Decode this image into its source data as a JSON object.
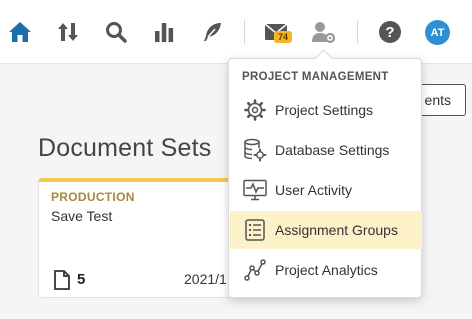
{
  "topbar": {
    "nav": [
      {
        "name": "home-icon",
        "active": true
      },
      {
        "name": "sort-arrows-icon"
      },
      {
        "name": "search-icon"
      },
      {
        "name": "bar-chart-icon"
      },
      {
        "name": "feather-icon"
      },
      {
        "name": "mail-icon"
      },
      {
        "name": "user-settings-icon"
      },
      {
        "name": "help-icon"
      }
    ],
    "mail_badge": "74",
    "avatar_initials": "AT",
    "accent_color": "#1b6fa6"
  },
  "background": {
    "button_label": "ents",
    "section_title": "Document Sets",
    "card": {
      "tag": "PRODUCTION",
      "name": "Save Test",
      "doc_count": "5",
      "date": "2021/1",
      "tag_color": "#a8883a",
      "border_color": "#f2c94c"
    }
  },
  "dropdown": {
    "header": "PROJECT MANAGEMENT",
    "items": [
      {
        "label": "Project Settings",
        "icon": "gear-icon"
      },
      {
        "label": "Database Settings",
        "icon": "database-gear-icon"
      },
      {
        "label": "User Activity",
        "icon": "monitor-activity-icon"
      },
      {
        "label": "Assignment Groups",
        "icon": "checklist-icon",
        "active": true
      },
      {
        "label": "Project Analytics",
        "icon": "analytics-icon"
      }
    ],
    "active_bg": "#fdf1c9"
  }
}
